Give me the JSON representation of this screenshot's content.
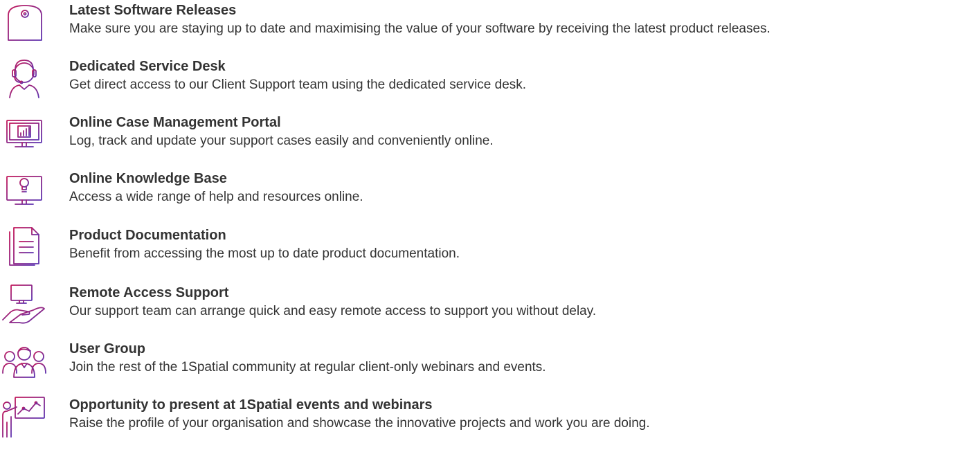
{
  "colors": {
    "icon_gradient_start": "#c2185b",
    "icon_gradient_end": "#5e35b1",
    "text": "#333333"
  },
  "items": [
    {
      "icon": "disc-box-icon",
      "title": "Latest Software Releases",
      "description": "Make sure you are staying up to date and maximising the value of your software by receiving the latest product releases."
    },
    {
      "icon": "headset-agent-icon",
      "title": "Dedicated Service Desk",
      "description": "Get direct access to our Client Support team using the dedicated service desk."
    },
    {
      "icon": "monitor-chart-icon",
      "title": "Online Case Management Portal",
      "description": "Log, track and update your support cases easily and conveniently online."
    },
    {
      "icon": "monitor-lightbulb-icon",
      "title": "Online Knowledge Base",
      "description": "Access a wide range of help and resources online."
    },
    {
      "icon": "documents-icon",
      "title": "Product Documentation",
      "description": "Benefit from accessing the most up to date product documentation."
    },
    {
      "icon": "hand-monitor-icon",
      "title": "Remote Access Support",
      "description": "Our support team can arrange quick and easy remote access to support you without delay."
    },
    {
      "icon": "user-group-icon",
      "title": "User Group",
      "description": "Join the rest of the 1Spatial community at regular client-only webinars and events."
    },
    {
      "icon": "presenter-chart-icon",
      "title": "Opportunity to present at 1Spatial events and webinars",
      "description": "Raise the profile of your organisation and showcase the innovative projects and work you are doing."
    }
  ]
}
